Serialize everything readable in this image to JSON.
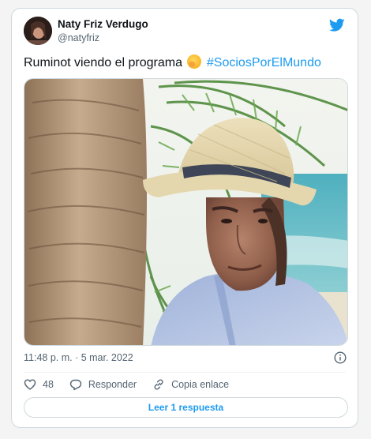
{
  "tweet": {
    "author_name": "Naty Friz Verdugo",
    "author_handle": "@natyfriz",
    "text_before": "Ruminot viendo el programa ",
    "emoji": "face-with-hand-over-mouth",
    "hashtag": "#SociosPorElMundo",
    "timestamp": "11:48 p. m. · 5 mar. 2022"
  },
  "actions": {
    "likes_count": "48",
    "reply_label": "Responder",
    "copy_link_label": "Copia enlace"
  },
  "replies_button": "Leer 1 respuesta",
  "colors": {
    "accent": "#1d9bf0",
    "text": "#0f1419",
    "secondary_text": "#536471",
    "border": "#cfd9de"
  },
  "icons": [
    "twitter-bird-icon",
    "info-icon",
    "heart-icon",
    "reply-icon",
    "link-icon"
  ]
}
